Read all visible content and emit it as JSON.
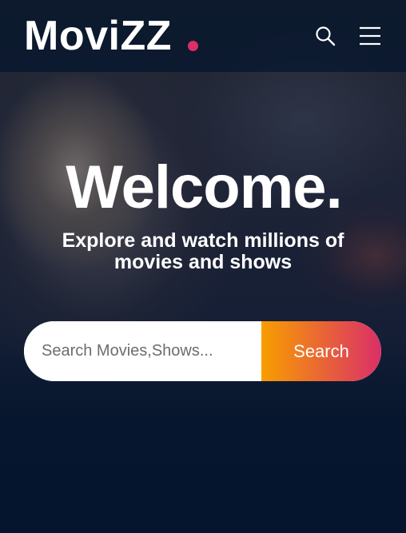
{
  "header": {
    "logo_text": "MoviZZ",
    "icons": [
      "search-icon",
      "menu-icon"
    ]
  },
  "hero": {
    "title": "Welcome.",
    "subtitle": "Explore and watch millions of movies and shows"
  },
  "search": {
    "placeholder": "Search Movies,Shows...",
    "value": "",
    "button_label": "Search"
  },
  "colors": {
    "background": "#04152d",
    "accent_dot": "#da2f68",
    "button_gradient_start": "#f89e00",
    "button_gradient_end": "#da2f68",
    "text": "#ffffff"
  }
}
